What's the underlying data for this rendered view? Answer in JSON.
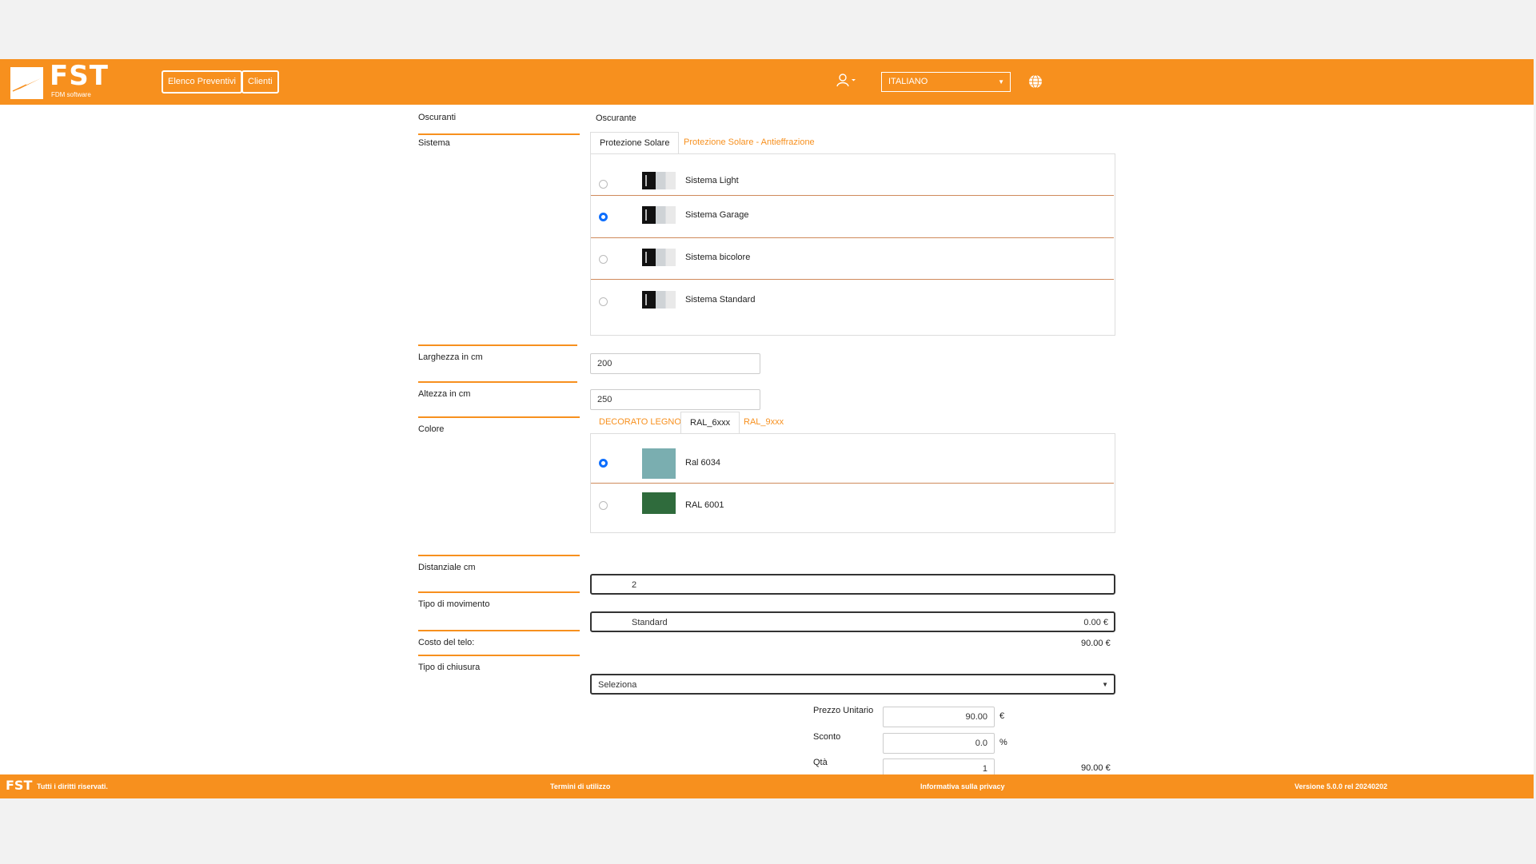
{
  "header": {
    "logo_text": "FST",
    "logo_subtitle": "FDM software",
    "nav": {
      "quotes_label": "Elenco Preventivi",
      "clients_label": "Clienti"
    },
    "language": "ITALIANO",
    "colors": {
      "brand": "#f7901e"
    }
  },
  "form": {
    "oscuranti": {
      "label": "Oscuranti",
      "value": "Oscurante"
    },
    "sistema": {
      "label": "Sistema",
      "tabs": [
        "Protezione Solare",
        "Protezione Solare - Antieffrazione"
      ],
      "active_tab": 0,
      "options": [
        {
          "label": "Sistema Light",
          "selected": false
        },
        {
          "label": "Sistema Garage",
          "selected": true
        },
        {
          "label": "Sistema bicolore",
          "selected": false
        },
        {
          "label": "Sistema Standard",
          "selected": false
        }
      ]
    },
    "larghezza": {
      "label": "Larghezza in cm",
      "value": "200"
    },
    "altezza": {
      "label": "Altezza in cm",
      "value": "250"
    },
    "colore": {
      "label": "Colore",
      "tabs": [
        "DECORATO LEGNO",
        "RAL_6xxx",
        "RAL_9xxx"
      ],
      "active_tab": 1,
      "options": [
        {
          "label": "Ral 6034",
          "selected": true,
          "color": "#7aaeb0"
        },
        {
          "label": "RAL 6001",
          "selected": false,
          "color": "#2f6b3c"
        }
      ]
    },
    "distanziale": {
      "label": "Distanziale cm",
      "value": "2"
    },
    "movimento": {
      "label": "Tipo di movimento",
      "value": "Standard",
      "price": "0.00 €"
    },
    "costo_telo": {
      "label": "Costo del telo:",
      "value": "90.00 €"
    },
    "chiusura": {
      "label": "Tipo di chiusura",
      "value": "Seleziona"
    },
    "prezzo_unitario": {
      "label": "Prezzo Unitario",
      "value": "90.00",
      "unit": "€"
    },
    "sconto": {
      "label": "Sconto",
      "value": "0.0",
      "unit": "%"
    },
    "qta": {
      "label": "Qtà",
      "value": "1",
      "total": "90.00 €"
    }
  },
  "footer": {
    "logo_text": "FST",
    "rights": "Tutti i diritti riservati.",
    "terms": "Termini di utilizzo",
    "privacy": "Informativa sulla privacy",
    "version": "Versione 5.0.0 rel 20240202"
  }
}
